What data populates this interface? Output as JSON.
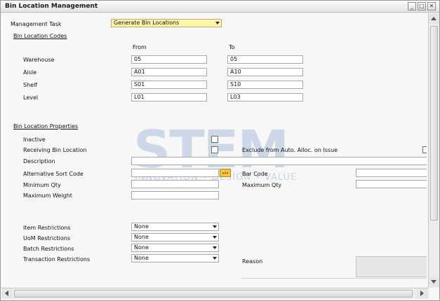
{
  "window": {
    "title": "Bin Location Management"
  },
  "management_task": {
    "label": "Management Task",
    "value": "Generate Bin Locations"
  },
  "codes": {
    "section_label": "Bin Location Codes",
    "from_label": "From",
    "to_label": "To",
    "rows": [
      {
        "label": "Warehouse",
        "from": "05",
        "to": "05"
      },
      {
        "label": "Aisle",
        "from": "A01",
        "to": "A10"
      },
      {
        "label": "Shelf",
        "from": "S01",
        "to": "S10"
      },
      {
        "label": "Level",
        "from": "L01",
        "to": "L03"
      }
    ]
  },
  "properties": {
    "section_label": "Bin Location Properties",
    "inactive_label": "Inactive",
    "receiving_label": "Receiving Bin Location",
    "exclude_label": "Exclude from Auto. Alloc. on Issue",
    "description_label": "Description",
    "alt_sort_label": "Alternative Sort Code",
    "bar_code_label": "Bar Code",
    "min_qty_label": "Minimum Qty",
    "max_qty_label": "Maximum Qty",
    "max_weight_label": "Maximum Weight",
    "browse_button": "..."
  },
  "restrictions": [
    {
      "label": "Item Restrictions",
      "value": "None"
    },
    {
      "label": "UoM Restrictions",
      "value": "None"
    },
    {
      "label": "Batch Restrictions",
      "value": "None"
    },
    {
      "label": "Transaction Restrictions",
      "value": "None"
    }
  ],
  "reason_label": "Reason",
  "watermark": {
    "big": "STEM",
    "sub": "INNOVATION • DESIGN • VALUE",
    "reg": "®"
  }
}
